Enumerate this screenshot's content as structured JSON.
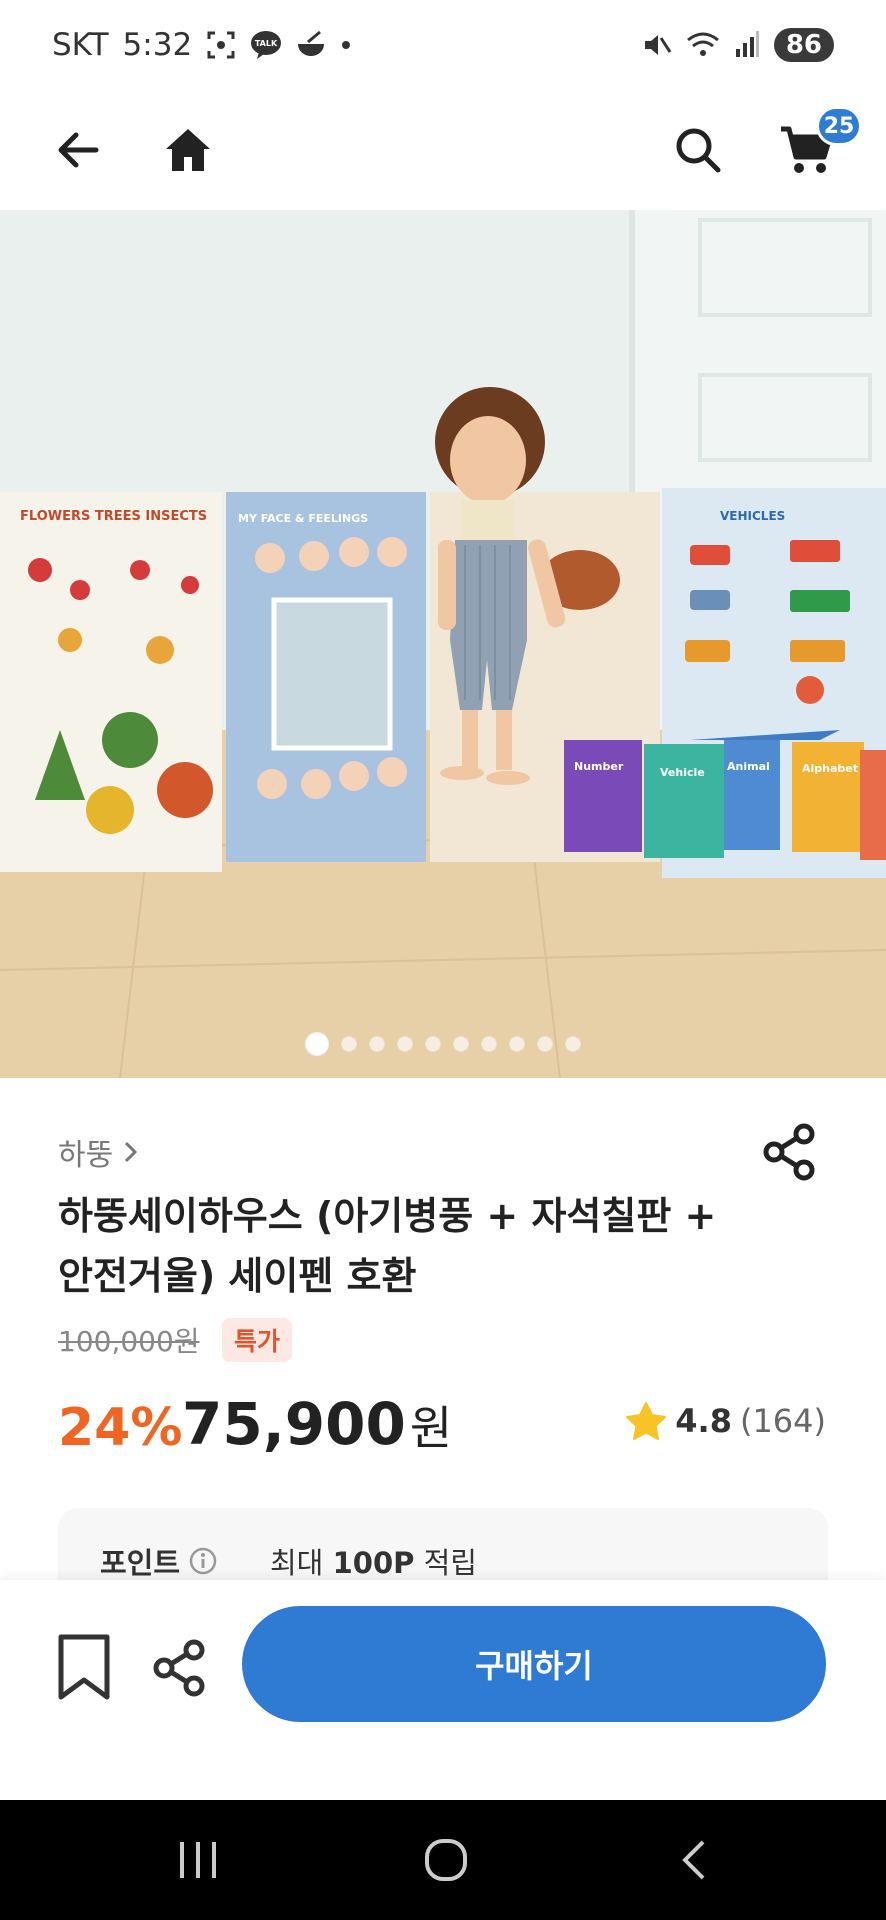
{
  "status_bar": {
    "carrier": "SKT",
    "time": "5:32",
    "talk_label": "TALK",
    "battery": "86"
  },
  "header": {
    "cart_count": "25",
    "icons": [
      "back-arrow-icon",
      "home-icon",
      "search-icon",
      "cart-icon"
    ]
  },
  "gallery": {
    "image_count": 10,
    "active_index": 0,
    "image_texts": {
      "panel1": "FLOWERS TREES INSECTS",
      "panel2": "MY FACE & FEELINGS",
      "panel3": "VEHICLES",
      "book1": "Number",
      "book2": "Vehicle",
      "book3": "Animal",
      "book4": "Alphabet"
    }
  },
  "product": {
    "brand": "하뚱",
    "title": "하뚱세이하우스 (아기병풍 + 자석칠판 + 안전거울) 세이펜 호환",
    "original_price": "100,000원",
    "tag": "특가",
    "discount": "24%",
    "price": "75,900",
    "currency": "원",
    "rating": "4.8",
    "review_count": "(164)"
  },
  "points": {
    "label": "포인트",
    "prefix": "최대",
    "amount": "100P",
    "suffix": "적립"
  },
  "actions": {
    "buy_label": "구매하기"
  },
  "colors": {
    "accent": "#2f7bd3",
    "discount": "#f06522",
    "tag_bg": "#fde8e3",
    "star": "#f7c325"
  }
}
